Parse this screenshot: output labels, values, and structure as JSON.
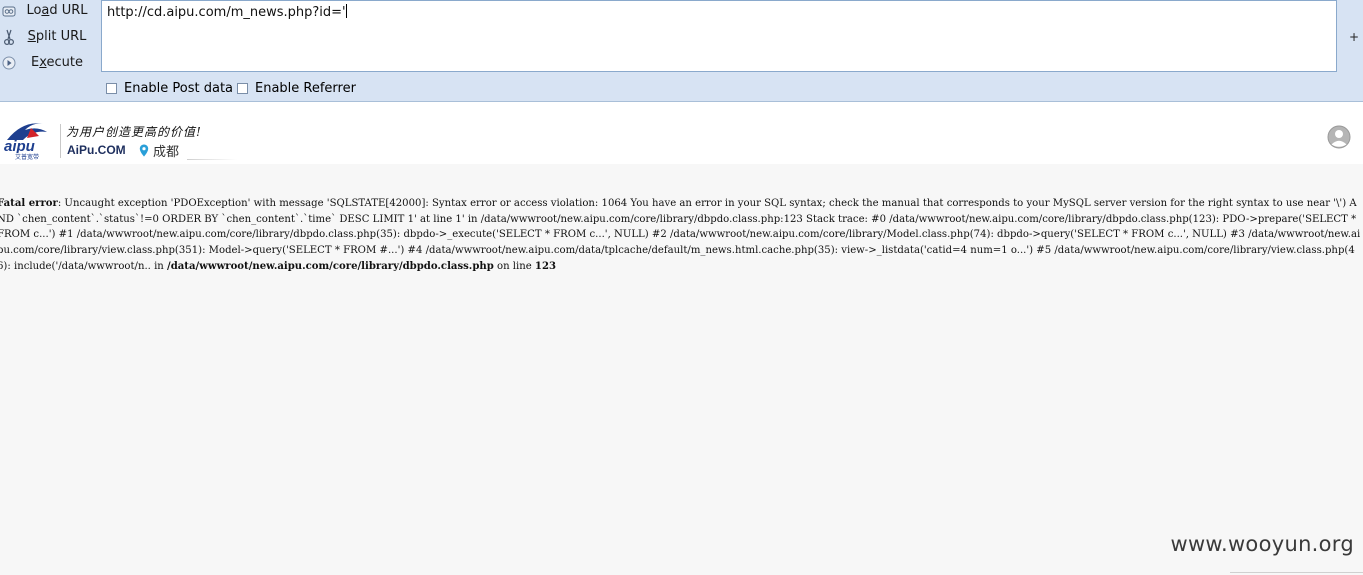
{
  "hackbar": {
    "buttons": {
      "load_pre": "Lo",
      "load_u": "a",
      "load_post": "d URL",
      "split_u": "S",
      "split_post": "plit URL",
      "exec_pre": "E",
      "exec_u": "x",
      "exec_post": "ecute"
    },
    "url_value": "http://cd.aipu.com/m_news.php?id='",
    "enable_post_label": "Enable Post data",
    "enable_referrer_label": "Enable Referrer",
    "plus_label": "+"
  },
  "site": {
    "logo_alt": "aipu 艾普宽带",
    "slogan": "为用户创造更高的价值!",
    "brand": "AiPu.COM",
    "city": "成都"
  },
  "error": {
    "label": "Fatal error",
    "message": ": Uncaught exception 'PDOException' with message 'SQLSTATE[42000]: Syntax error or access violation: 1064 You have an error in your SQL syntax; check the manual that corresponds to your MySQL server version for the right syntax to use near '\\') AND `chen_content`.`status`!=0 ORDER BY `chen_content`.`time` DESC LIMIT 1' at line 1' in /data/wwwroot/new.aipu.com/core/library/dbpdo.class.php:123 Stack trace: #0 /data/wwwroot/new.aipu.com/core/library/dbpdo.class.php(123): PDO->prepare('SELECT * FROM c...') #1 /data/wwwroot/new.aipu.com/core/library/dbpdo.class.php(35): dbpdo->_execute('SELECT * FROM c...', NULL) #2 /data/wwwroot/new.aipu.com/core/library/Model.class.php(74): dbpdo->query('SELECT * FROM c...', NULL) #3 /data/wwwroot/new.aipu.com/core/library/view.class.php(351): Model->query('SELECT * FROM #...') #4 /data/wwwroot/new.aipu.com/data/tplcache/default/m_news.html.cache.php(35): view->_listdata('catid=4 num=1 o...') #5 /data/wwwroot/new.aipu.com/core/library/view.class.php(46): include('/data/wwwroot/n..",
    "in_text": " in ",
    "file": "/data/wwwroot/new.aipu.com/core/library/dbpdo.class.php",
    "on_line_text": " on line ",
    "line": "123"
  },
  "watermark": "www.wooyun.org",
  "colors": {
    "toolbar_bg": "#d7e3f3",
    "page_bg": "#f7f7f7",
    "logo_blue": "#1e3f8f"
  },
  "icons": {
    "load": "load-url-icon",
    "split": "scissors-icon",
    "execute": "play-icon",
    "avatar": "user-avatar-icon",
    "city": "location-pin-icon"
  }
}
